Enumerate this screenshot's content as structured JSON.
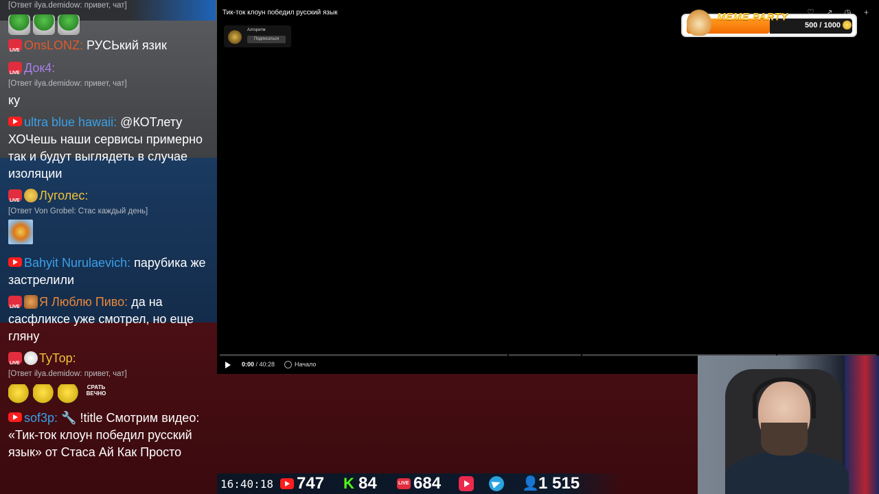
{
  "chat": {
    "top_reply": "[Ответ ilya.demidow: привет, чат]",
    "messages": [
      {
        "platform": "live",
        "name": "OnsLONZ:",
        "name_color": "#e05a2b",
        "text": "РУСЬкий язик"
      },
      {
        "platform": "live",
        "name": "Док4:",
        "name_color": "#a97fe6",
        "text": "",
        "reply": "[Ответ ilya.demidow: привет, чат]",
        "text2": "ку"
      },
      {
        "platform": "yt",
        "name": "ultra blue hawaii:",
        "name_color": "#3aa0e8",
        "text": "@КОТлету ХОЧешь наши сервисы примерно так и будут выглядеть в случае изоляции"
      },
      {
        "platform": "live",
        "name": "Луголес:",
        "name_color": "#f0c23a",
        "reply": "[Ответ Von Grobel: Стас каждый день]"
      },
      {
        "platform": "yt",
        "name": "Bahyit Nurulaevich:",
        "name_color": "#3aa0e8",
        "text": "парубика же застрелили"
      },
      {
        "platform": "live",
        "name": "Я Люблю Пиво:",
        "name_color": "#e8883a",
        "text": "да на сасфликсе уже смотрел, но еще гляну"
      },
      {
        "platform": "live",
        "name": "ТуТор:",
        "name_color": "#f0c23a",
        "reply": "[Ответ ilya.demidow: привет, чат]",
        "emote_caption": "СРАТЬ ВЕЧНО"
      },
      {
        "platform": "yt",
        "name": "sof3p:",
        "name_color": "#3aa0e8",
        "text": "!title Смотрим видео: «Тик-ток клоун победил русский язык» от Стаса Ай Как Просто"
      }
    ]
  },
  "video": {
    "title": "Тик-ток клоун победил русский язык",
    "channel_name": "Алгоритм",
    "subscribe_label": "Подписаться",
    "time_current": "0:00",
    "time_total": "/ 40:28",
    "chapter": "Начало"
  },
  "meme_party": {
    "title": "MEME PARTY",
    "value": "500 / 1000",
    "progress": 0.5
  },
  "stats": {
    "clock": "16:40:18",
    "youtube": "747",
    "kick": "84",
    "vk": "684",
    "total": "1 515"
  }
}
